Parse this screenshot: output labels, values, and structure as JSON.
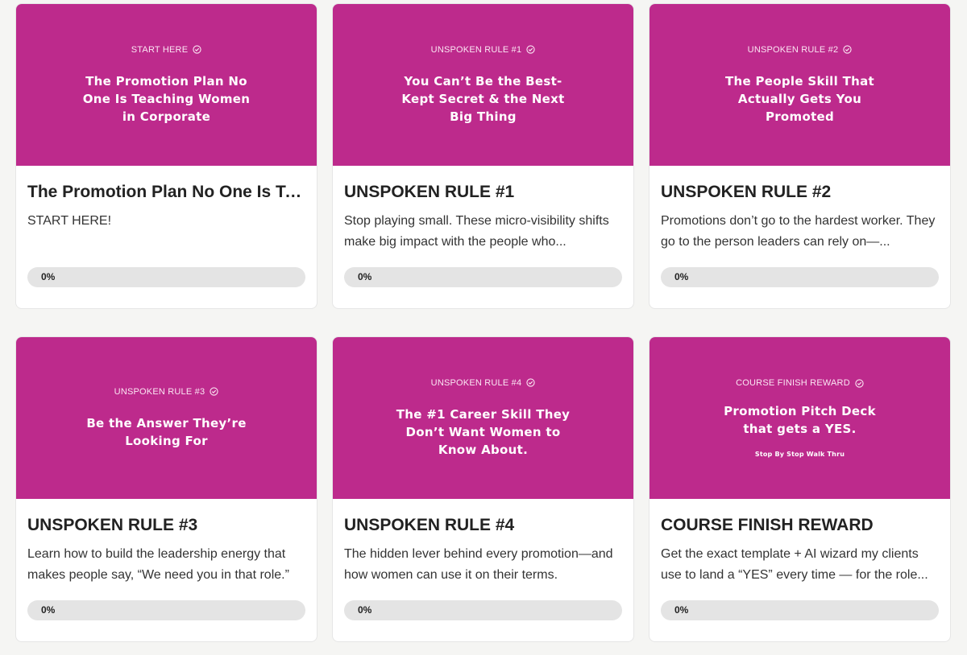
{
  "theme": {
    "thumb_color": "#bd2a8c",
    "progress_track": "#e4e4e4"
  },
  "courses": [
    {
      "thumb_eyebrow": "START HERE",
      "thumb_title": "The Promotion Plan No One Is Teaching Women in Corporate",
      "thumb_sub": "",
      "title": "The Promotion Plan No One Is Te...",
      "description": "START HERE!",
      "progress_label": "0%",
      "progress": 0
    },
    {
      "thumb_eyebrow": "UNSPOKEN RULE #1",
      "thumb_title": "You Can’t Be the Best-Kept Secret & the Next Big Thing",
      "thumb_sub": "",
      "title": "UNSPOKEN RULE #1",
      "description": "Stop playing small. These micro-visibility shifts make big impact with the people who...",
      "progress_label": "0%",
      "progress": 0
    },
    {
      "thumb_eyebrow": "UNSPOKEN RULE #2",
      "thumb_title": "The People Skill That Actually Gets You Promoted",
      "thumb_sub": "",
      "title": "UNSPOKEN RULE #2",
      "description": "Promotions don’t go to the hardest worker. They go to the person leaders can rely on—...",
      "progress_label": "0%",
      "progress": 0
    },
    {
      "thumb_eyebrow": "UNSPOKEN RULE #3",
      "thumb_title": "Be the Answer They’re Looking For",
      "thumb_sub": "",
      "title": "UNSPOKEN RULE #3",
      "description": "Learn how to build the leadership energy that makes people say, “We need you in that role.”",
      "progress_label": "0%",
      "progress": 0
    },
    {
      "thumb_eyebrow": "UNSPOKEN RULE #4",
      "thumb_title": "The #1 Career Skill They Don’t Want Women to Know About.",
      "thumb_sub": "",
      "title": "UNSPOKEN RULE #4",
      "description": "The hidden lever behind every promotion—and how women can use it on their terms.",
      "progress_label": "0%",
      "progress": 0
    },
    {
      "thumb_eyebrow": "COURSE FINISH REWARD",
      "thumb_title": "Promotion Pitch Deck that gets a YES.",
      "thumb_sub": "Stop By Stop Walk Thru",
      "title": "COURSE FINISH REWARD",
      "description": "Get the exact template + AI wizard my clients use to land a “YES” every time — for the role...",
      "progress_label": "0%",
      "progress": 0
    }
  ]
}
